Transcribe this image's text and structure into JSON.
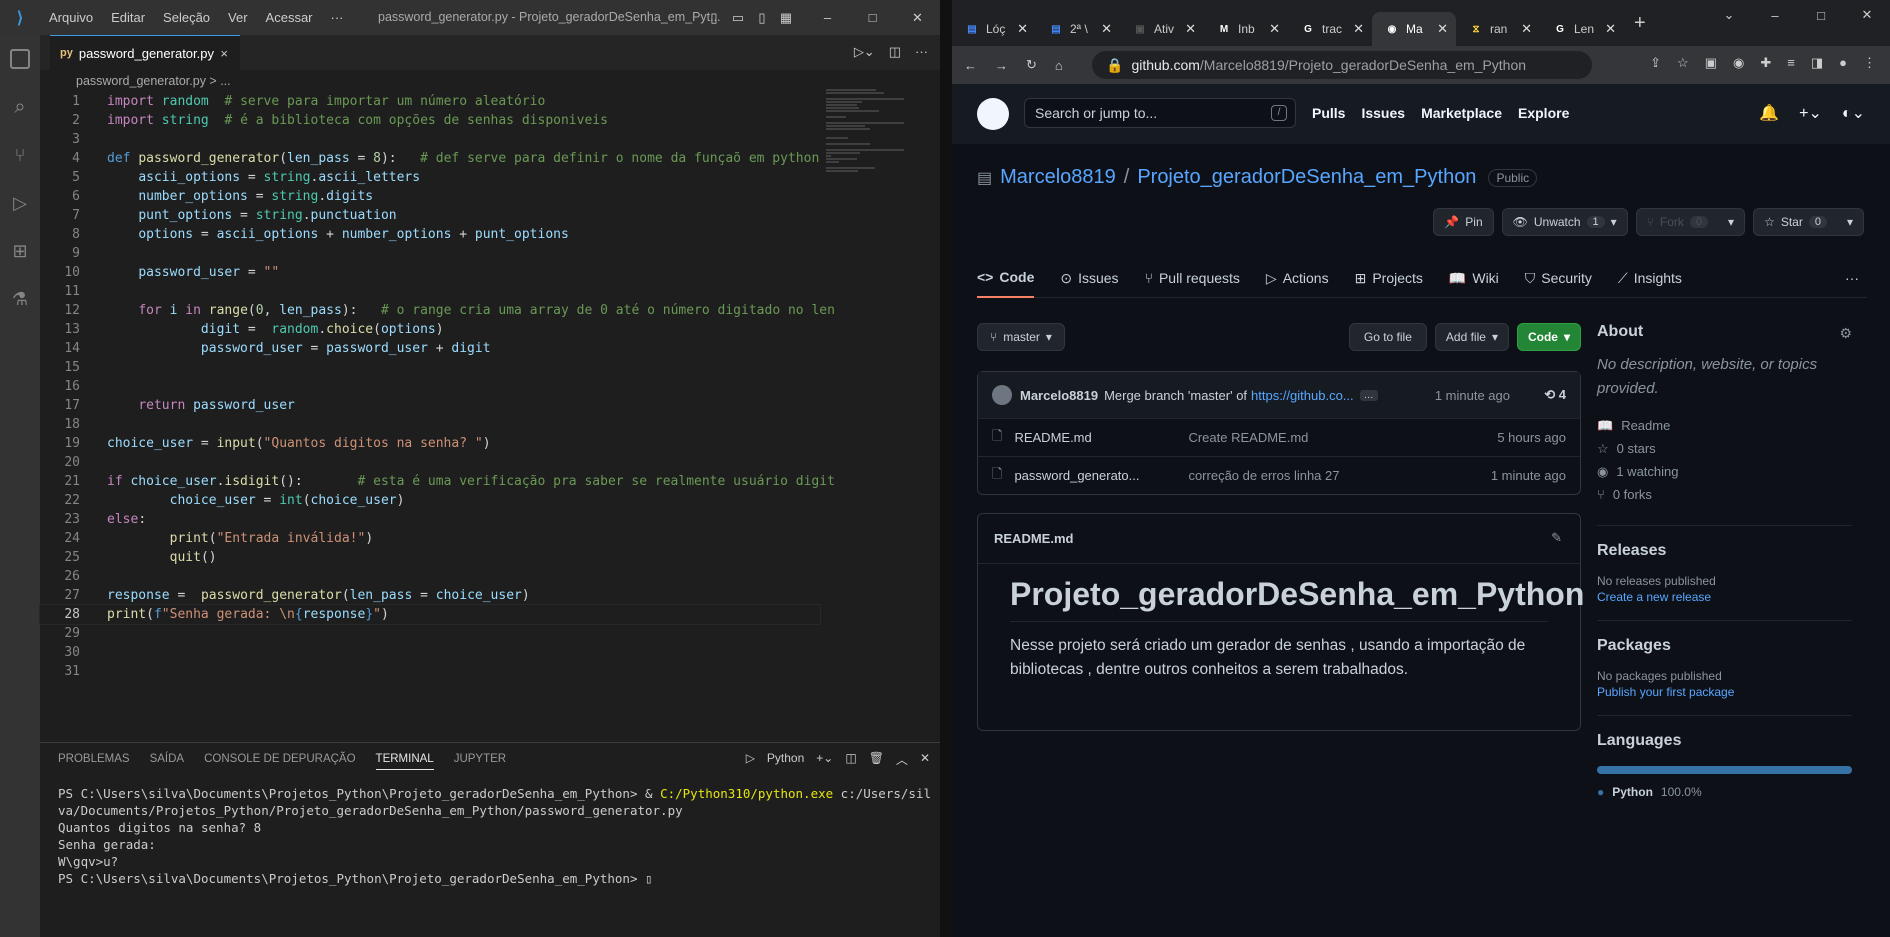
{
  "vscode": {
    "menu": [
      "Arquivo",
      "Editar",
      "Seleção",
      "Ver",
      "Acessar",
      "···"
    ],
    "window_title": "password_generator.py - Projeto_geradorDeSenha_em_Pyt...",
    "tab": {
      "label": "password_generator.py",
      "close": "×"
    },
    "breadcrumb": "password_generator.py > ...",
    "code": [
      [
        [
          "k",
          "import"
        ],
        [
          "p",
          " "
        ],
        [
          "t",
          "random"
        ],
        [
          "p",
          "  "
        ],
        [
          "c",
          "# serve para importar um número aleatório"
        ]
      ],
      [
        [
          "k",
          "import"
        ],
        [
          "p",
          " "
        ],
        [
          "t",
          "string"
        ],
        [
          "p",
          "  "
        ],
        [
          "c",
          "# é a biblioteca com opções de senhas disponiveis"
        ]
      ],
      [],
      [
        [
          "kb",
          "def"
        ],
        [
          "p",
          " "
        ],
        [
          "f",
          "password_generator"
        ],
        [
          "p",
          "("
        ],
        [
          "v",
          "len_pass"
        ],
        [
          "p",
          " = "
        ],
        [
          "n",
          "8"
        ],
        [
          "p",
          "):   "
        ],
        [
          "c",
          "# def serve para definir o nome da funçaõ em python"
        ]
      ],
      [
        [
          "p",
          "    "
        ],
        [
          "v",
          "ascii_options"
        ],
        [
          "p",
          " = "
        ],
        [
          "t",
          "string"
        ],
        [
          "p",
          "."
        ],
        [
          "v",
          "ascii_letters"
        ]
      ],
      [
        [
          "p",
          "    "
        ],
        [
          "v",
          "number_options"
        ],
        [
          "p",
          " = "
        ],
        [
          "t",
          "string"
        ],
        [
          "p",
          "."
        ],
        [
          "v",
          "digits"
        ]
      ],
      [
        [
          "p",
          "    "
        ],
        [
          "v",
          "punt_options"
        ],
        [
          "p",
          " = "
        ],
        [
          "t",
          "string"
        ],
        [
          "p",
          "."
        ],
        [
          "v",
          "punctuation"
        ]
      ],
      [
        [
          "p",
          "    "
        ],
        [
          "v",
          "options"
        ],
        [
          "p",
          " = "
        ],
        [
          "v",
          "ascii_options"
        ],
        [
          "p",
          " + "
        ],
        [
          "v",
          "number_options"
        ],
        [
          "p",
          " + "
        ],
        [
          "v",
          "punt_options"
        ]
      ],
      [],
      [
        [
          "p",
          "    "
        ],
        [
          "v",
          "password_user"
        ],
        [
          "p",
          " = "
        ],
        [
          "s",
          "\"\""
        ]
      ],
      [],
      [
        [
          "p",
          "    "
        ],
        [
          "k",
          "for"
        ],
        [
          "p",
          " "
        ],
        [
          "v",
          "i"
        ],
        [
          "p",
          " "
        ],
        [
          "k",
          "in"
        ],
        [
          "p",
          " "
        ],
        [
          "f",
          "range"
        ],
        [
          "p",
          "("
        ],
        [
          "n",
          "0"
        ],
        [
          "p",
          ", "
        ],
        [
          "v",
          "len_pass"
        ],
        [
          "p",
          "):   "
        ],
        [
          "c",
          "# o range cria uma array de 0 até o número digitado no len"
        ]
      ],
      [
        [
          "p",
          "            "
        ],
        [
          "v",
          "digit"
        ],
        [
          "p",
          " =  "
        ],
        [
          "t",
          "random"
        ],
        [
          "p",
          "."
        ],
        [
          "f",
          "choice"
        ],
        [
          "p",
          "("
        ],
        [
          "v",
          "options"
        ],
        [
          "p",
          ")"
        ]
      ],
      [
        [
          "p",
          "            "
        ],
        [
          "v",
          "password_user"
        ],
        [
          "p",
          " = "
        ],
        [
          "v",
          "password_user"
        ],
        [
          "p",
          " + "
        ],
        [
          "v",
          "digit"
        ]
      ],
      [],
      [],
      [
        [
          "p",
          "    "
        ],
        [
          "k",
          "return"
        ],
        [
          "p",
          " "
        ],
        [
          "v",
          "password_user"
        ]
      ],
      [],
      [
        [
          "v",
          "choice_user"
        ],
        [
          "p",
          " = "
        ],
        [
          "f",
          "input"
        ],
        [
          "p",
          "("
        ],
        [
          "s",
          "\"Quantos digitos na senha? \""
        ],
        [
          "p",
          ")"
        ]
      ],
      [],
      [
        [
          "k",
          "if"
        ],
        [
          "p",
          " "
        ],
        [
          "v",
          "choice_user"
        ],
        [
          "p",
          "."
        ],
        [
          "f",
          "isdigit"
        ],
        [
          "p",
          "():       "
        ],
        [
          "c",
          "# esta é uma verificação pra saber se realmente usuário digit"
        ]
      ],
      [
        [
          "p",
          "        "
        ],
        [
          "v",
          "choice_user"
        ],
        [
          "p",
          " = "
        ],
        [
          "t",
          "int"
        ],
        [
          "p",
          "("
        ],
        [
          "v",
          "choice_user"
        ],
        [
          "p",
          ")"
        ]
      ],
      [
        [
          "k",
          "else"
        ],
        [
          "p",
          ":"
        ]
      ],
      [
        [
          "p",
          "        "
        ],
        [
          "f",
          "print"
        ],
        [
          "p",
          "("
        ],
        [
          "s",
          "\"Entrada inválida!\""
        ],
        [
          "p",
          ")"
        ]
      ],
      [
        [
          "p",
          "        "
        ],
        [
          "f",
          "quit"
        ],
        [
          "p",
          "()"
        ]
      ],
      [],
      [
        [
          "v",
          "response"
        ],
        [
          "p",
          " =  "
        ],
        [
          "f",
          "password_generator"
        ],
        [
          "p",
          "("
        ],
        [
          "v",
          "len_pass"
        ],
        [
          "p",
          " = "
        ],
        [
          "v",
          "choice_user"
        ],
        [
          "p",
          ")"
        ]
      ],
      [
        [
          "f",
          "print"
        ],
        [
          "p",
          "("
        ],
        [
          "kb",
          "f"
        ],
        [
          "s",
          "\"Senha gerada: \\n"
        ],
        [
          "kb",
          "{"
        ],
        [
          "v",
          "response"
        ],
        [
          "kb",
          "}"
        ],
        [
          "s",
          "\""
        ],
        [
          "p",
          ")"
        ]
      ],
      [],
      [],
      []
    ],
    "panel_tabs": [
      "PROBLEMAS",
      "SAÍDA",
      "CONSOLE DE DEPURAÇÃO",
      "TERMINAL",
      "JUPYTER"
    ],
    "active_panel_tab": "TERMINAL",
    "terminal_shell": "Python",
    "terminal_lines": [
      "PS C:\\Users\\silva\\Documents\\Projetos_Python\\Projeto_geradorDeSenha_em_Python> & C:/Python310/python.exe c:/Users/sil",
      "va/Documents/Projetos_Python/Projeto_geradorDeSenha_em_Python/password_generator.py",
      "Quantos digitos na senha? 8",
      "Senha gerada:",
      "W\\gqv>u?",
      "PS C:\\Users\\silva\\Documents\\Projetos_Python\\Projeto_geradorDeSenha_em_Python> ▯"
    ]
  },
  "chrome": {
    "tabs": [
      {
        "label": "Lóç",
        "fav": "doc"
      },
      {
        "label": "2ª \\",
        "fav": "doc"
      },
      {
        "label": "Ativ",
        "fav": "class"
      },
      {
        "label": "Inb",
        "fav": "gmail"
      },
      {
        "label": "trac",
        "fav": "google"
      },
      {
        "label": "Ma",
        "fav": "github"
      },
      {
        "label": "ran",
        "fav": "python"
      },
      {
        "label": "Len",
        "fav": "google"
      }
    ],
    "url_host": "github.com",
    "url_path": "/Marcelo8819/Projeto_geradorDeSenha_em_Python"
  },
  "github": {
    "search_placeholder": "Search or jump to...",
    "search_key": "/",
    "nav": [
      "Pulls",
      "Issues",
      "Marketplace",
      "Explore"
    ],
    "owner": "Marcelo8819",
    "repo": "Projeto_geradorDeSenha_em_Python",
    "visibility": "Public",
    "pin": "Pin",
    "unwatch": "Unwatch",
    "watch_count": "1",
    "fork": "Fork",
    "fork_count": "0",
    "star": "Star",
    "star_count": "0",
    "tabs": [
      "Code",
      "Issues",
      "Pull requests",
      "Actions",
      "Projects",
      "Wiki",
      "Security",
      "Insights"
    ],
    "branch": "master",
    "go_to_file": "Go to file",
    "add_file": "Add file",
    "code_btn": "Code",
    "commit": {
      "author": "Marcelo8819",
      "message": "Merge branch 'master' of",
      "link": "https://github.co...",
      "time": "1 minute ago",
      "count": "4"
    },
    "files": [
      {
        "name": "README.md",
        "msg": "Create README.md",
        "time": "5 hours ago"
      },
      {
        "name": "password_generato...",
        "msg": "correção de erros linha 27",
        "time": "1 minute ago"
      }
    ],
    "readme_label": "README.md",
    "readme_title": "Projeto_geradorDeSenha_em_Python",
    "readme_text": "Nesse projeto será criado um gerador de senhas , usando a importação de bibliotecas , dentre outros conheitos a serem trabalhados.",
    "about": {
      "title": "About",
      "desc": "No description, website, or topics provided.",
      "items": [
        "Readme",
        "0 stars",
        "1 watching",
        "0 forks"
      ]
    },
    "releases": {
      "title": "Releases",
      "none": "No releases published",
      "link": "Create a new release"
    },
    "packages": {
      "title": "Packages",
      "none": "No packages published",
      "link": "Publish your first package"
    },
    "languages": {
      "title": "Languages",
      "name": "Python",
      "pct": "100.0%",
      "share": 1.0,
      "color": "#3572a5"
    }
  }
}
